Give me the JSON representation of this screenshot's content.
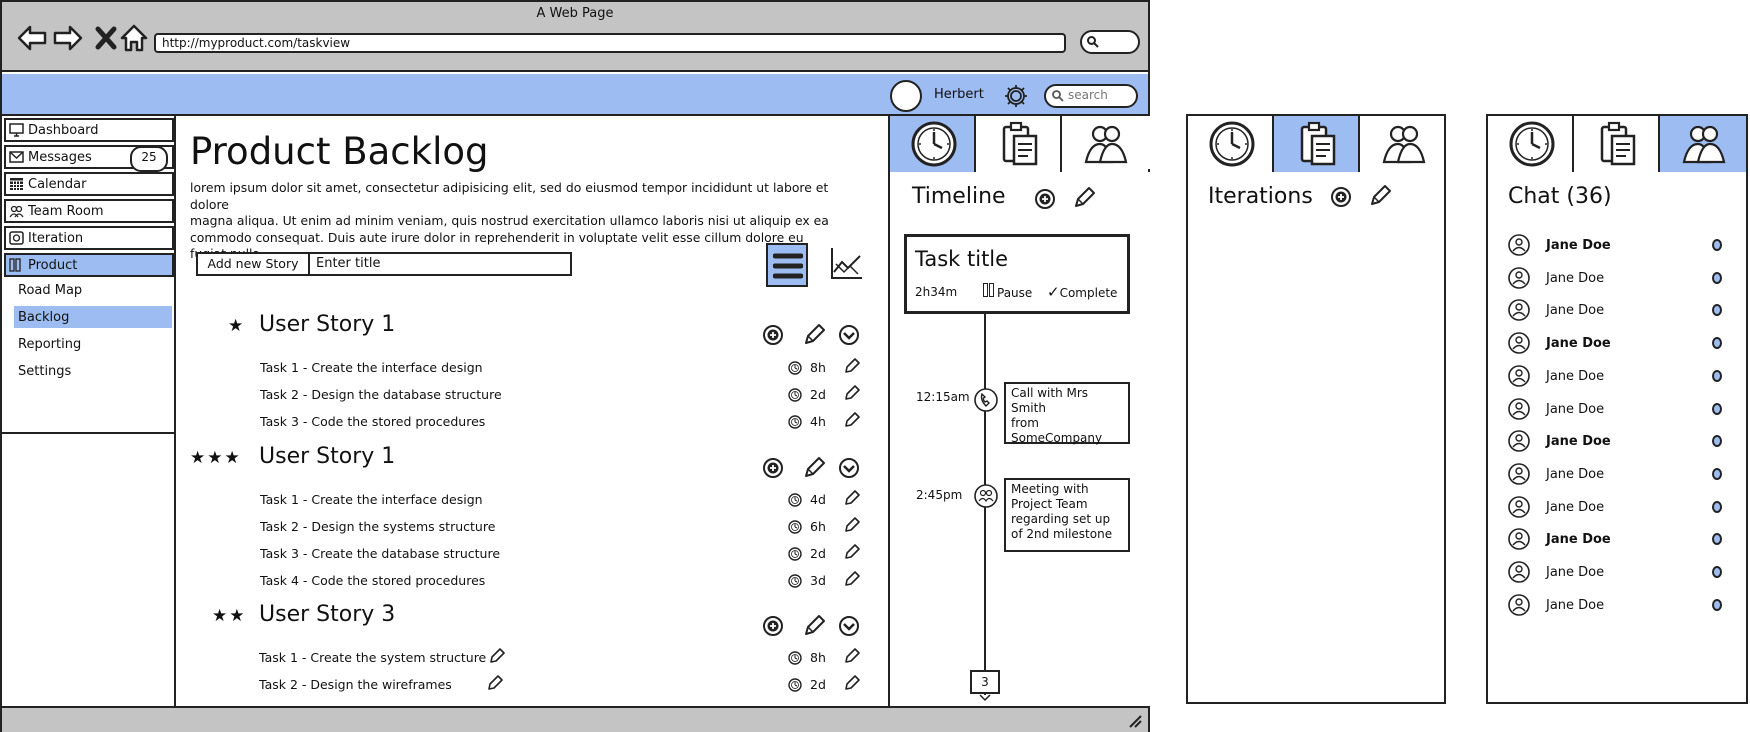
{
  "window": {
    "title": "A Web Page",
    "url": "http://myproduct.com/taskview"
  },
  "header": {
    "user_name": "Herbert",
    "search_placeholder": "search"
  },
  "sidebar": {
    "items": [
      {
        "label": "Dashboard",
        "icon": "monitor-icon"
      },
      {
        "label": "Messages",
        "icon": "envelope-icon",
        "badge": "25"
      },
      {
        "label": "Calendar",
        "icon": "calendar-icon"
      },
      {
        "label": "Team Room",
        "icon": "people-icon"
      },
      {
        "label": "Iteration",
        "icon": "iteration-icon"
      },
      {
        "label": "Product",
        "icon": "columns-icon",
        "active": true
      }
    ],
    "subitems": [
      {
        "label": "Road Map"
      },
      {
        "label": "Backlog",
        "active": true
      },
      {
        "label": "Reporting"
      },
      {
        "label": "Settings"
      }
    ]
  },
  "main": {
    "title": "Product Backlog",
    "description_lines": [
      "lorem ipsum dolor sit amet, consectetur adipisicing elit, sed do eiusmod tempor incididunt ut labore et dolore",
      "magna aliqua. Ut enim ad minim veniam, quis nostrud exercitation ullamco laboris nisi ut aliquip ex ea",
      "commodo consequat. Duis aute irure dolor in reprehenderit in voluptate velit esse cillum dolore eu fugiat nulla"
    ],
    "add_story_label": "Add new Story",
    "title_input_value": "Enter title",
    "stories": [
      {
        "stars": "★",
        "title": "User Story 1",
        "tasks": [
          {
            "label": "Task 1 - Create the interface design",
            "estimate": "8h"
          },
          {
            "label": "Task 2 - Design the database structure",
            "estimate": "2d"
          },
          {
            "label": "Task 3 - Code the stored procedures",
            "estimate": "4h"
          }
        ]
      },
      {
        "stars": "★★★",
        "title": "User Story 1",
        "tasks": [
          {
            "label": "Task 1 - Create the interface design",
            "estimate": "4d"
          },
          {
            "label": "Task 2 - Design the systems structure",
            "estimate": "6h"
          },
          {
            "label": "Task 3 - Create the database structure",
            "estimate": "2d"
          },
          {
            "label": "Task 4 - Code the stored procedures",
            "estimate": "3d"
          }
        ]
      },
      {
        "stars": "★★",
        "title": "User Story 3",
        "tasks": [
          {
            "label": "Task 1 - Create the system structure",
            "estimate": "8h"
          },
          {
            "label": "Task 2 - Design the wireframes",
            "estimate": "2d"
          }
        ]
      }
    ]
  },
  "timeline": {
    "title": "Timeline",
    "task_title": "Task title",
    "elapsed": "2h34m",
    "pause_label": "Pause",
    "complete_label": "Complete",
    "events": [
      {
        "time": "12:15am",
        "icon": "phone-icon",
        "text_lines": [
          "Call with Mrs Smith",
          "from",
          "SomeCompany"
        ]
      },
      {
        "time": "2:45pm",
        "icon": "meeting-icon",
        "text_lines": [
          "Meeting with",
          "Project Team",
          "regarding set up",
          "of 2nd milestone"
        ]
      }
    ],
    "count": "3"
  },
  "iterations": {
    "title": "Iterations"
  },
  "chat": {
    "title": "Chat (36)",
    "users": [
      {
        "name": "Jane Doe",
        "bold": true
      },
      {
        "name": "Jane Doe",
        "bold": false
      },
      {
        "name": "Jane Doe",
        "bold": false
      },
      {
        "name": "Jane Doe",
        "bold": true
      },
      {
        "name": "Jane Doe",
        "bold": false
      },
      {
        "name": "Jane Doe",
        "bold": false
      },
      {
        "name": "Jane Doe",
        "bold": true
      },
      {
        "name": "Jane Doe",
        "bold": false
      },
      {
        "name": "Jane Doe",
        "bold": false
      },
      {
        "name": "Jane Doe",
        "bold": true
      },
      {
        "name": "Jane Doe",
        "bold": false
      },
      {
        "name": "Jane Doe",
        "bold": false
      }
    ]
  },
  "colors": {
    "accent": "#9dbdf2",
    "chrome": "#c4c4c4",
    "ink": "#222222"
  }
}
